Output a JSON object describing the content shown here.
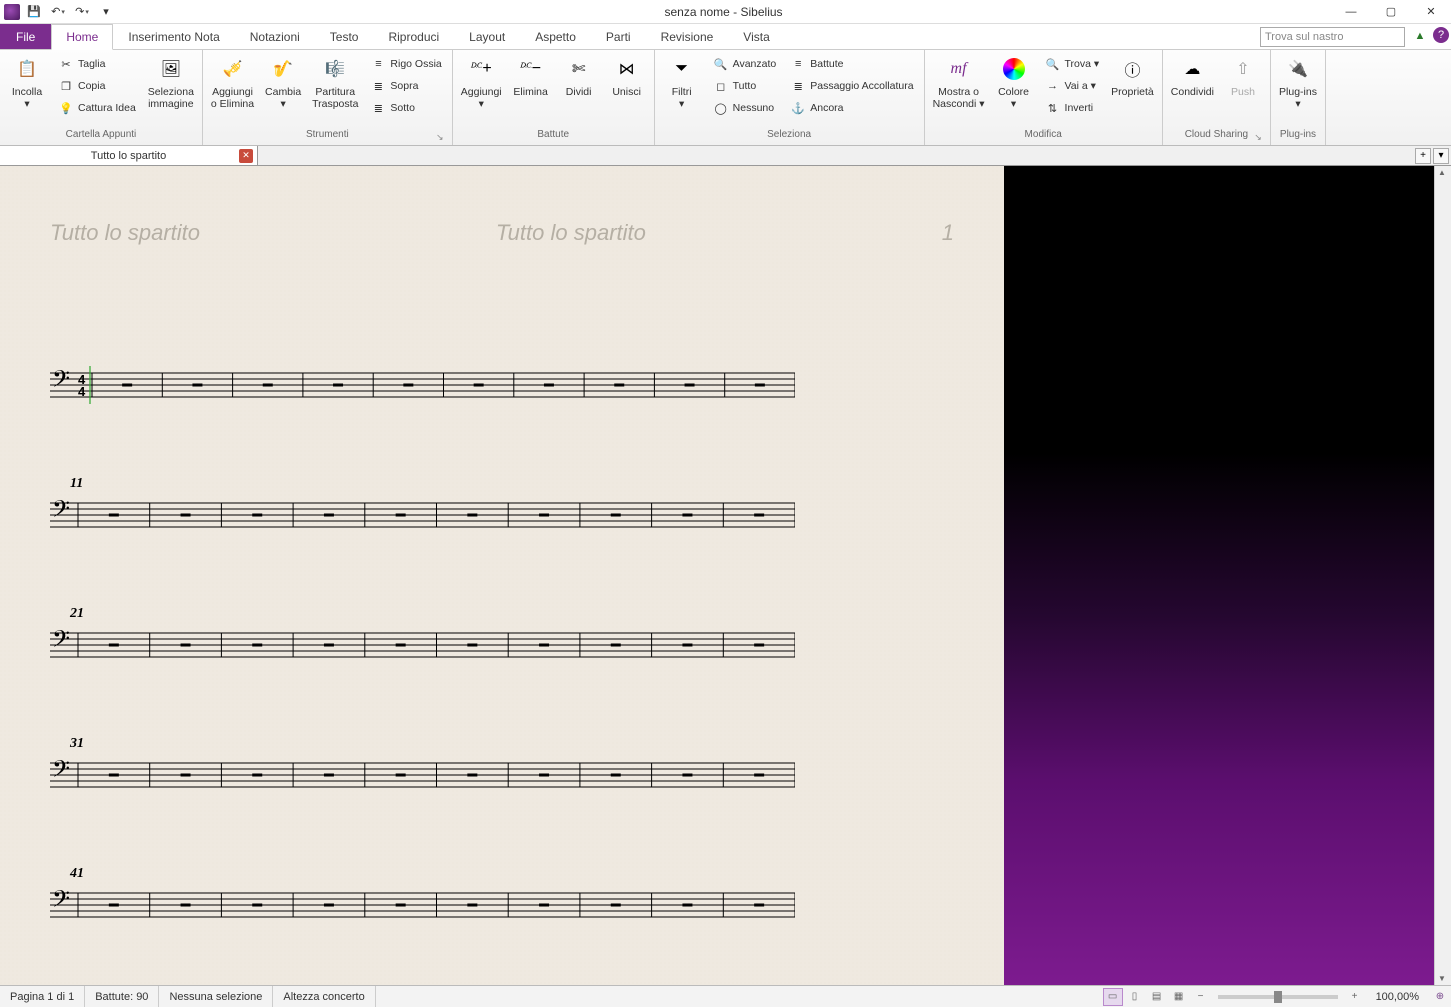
{
  "titlebar": {
    "title": "senza nome - Sibelius"
  },
  "qat": {
    "undo_tip": "↶",
    "redo_tip": "↷"
  },
  "tabs": {
    "file": "File",
    "items": [
      "Home",
      "Inserimento Nota",
      "Notazioni",
      "Testo",
      "Riproduci",
      "Layout",
      "Aspetto",
      "Parti",
      "Revisione",
      "Vista"
    ],
    "active_index": 0,
    "search_placeholder": "Trova sul nastro"
  },
  "ribbon": {
    "groups": [
      {
        "label": "Cartella Appunti",
        "big": [
          {
            "id": "incolla",
            "label": "Incolla\n▾",
            "icon": "📋"
          }
        ],
        "mini": [
          {
            "id": "taglia",
            "icon": "✂",
            "label": "Taglia"
          },
          {
            "id": "copia",
            "icon": "❐",
            "label": "Copia"
          },
          {
            "id": "cattura",
            "icon": "💡",
            "label": "Cattura Idea"
          }
        ],
        "big2": [
          {
            "id": "selimg",
            "label": "Seleziona\nimmagine",
            "icon": "🖼"
          }
        ]
      },
      {
        "label": "Strumenti",
        "launcher": true,
        "big": [
          {
            "id": "aggelim",
            "label": "Aggiungi\no Elimina",
            "icon": "🎺"
          },
          {
            "id": "cambia",
            "label": "Cambia\n▾",
            "icon": "🎷"
          },
          {
            "id": "parttr",
            "label": "Partitura\nTrasposta",
            "icon": "🎼"
          }
        ],
        "mini": [
          {
            "id": "rigoossia",
            "icon": "≡",
            "label": "Rigo Ossia"
          },
          {
            "id": "sopra",
            "icon": "≣",
            "label": "Sopra"
          },
          {
            "id": "sotto",
            "icon": "≣",
            "label": "Sotto"
          }
        ]
      },
      {
        "label": "Battute",
        "big": [
          {
            "id": "battagg",
            "label": "Aggiungi\n▾",
            "icon": "𝄊+"
          },
          {
            "id": "battelim",
            "label": "Elimina",
            "icon": "𝄊−"
          },
          {
            "id": "battdiv",
            "label": "Dividi",
            "icon": "✄"
          },
          {
            "id": "battuni",
            "label": "Unisci",
            "icon": "⋈"
          }
        ]
      },
      {
        "label": "Seleziona",
        "big": [
          {
            "id": "filtri",
            "label": "Filtri\n▾",
            "icon": "⏷"
          }
        ],
        "mini": [
          {
            "id": "avanz",
            "icon": "🔍",
            "label": "Avanzato"
          },
          {
            "id": "tutto",
            "icon": "◻",
            "label": "Tutto"
          },
          {
            "id": "nessuno",
            "icon": "◯",
            "label": "Nessuno"
          }
        ],
        "mini2": [
          {
            "id": "selbatt",
            "icon": "≡",
            "label": "Battute"
          },
          {
            "id": "passacc",
            "icon": "≣",
            "label": "Passaggio Accollatura"
          },
          {
            "id": "ancora",
            "icon": "⚓",
            "label": "Ancora"
          }
        ]
      },
      {
        "label": "Modifica",
        "big": [
          {
            "id": "mostnasc",
            "label": "Mostra o\nNascondi ▾",
            "icon": "mf"
          },
          {
            "id": "colore",
            "label": "Colore\n▾",
            "icon": "◑"
          }
        ],
        "mini": [
          {
            "id": "trova",
            "icon": "🔍",
            "label": "Trova ▾"
          },
          {
            "id": "vaia",
            "icon": "→",
            "label": "Vai a ▾"
          },
          {
            "id": "inverti",
            "icon": "⇅",
            "label": "Inverti"
          }
        ],
        "big2": [
          {
            "id": "prop",
            "label": "Proprietà",
            "icon": "ⓘ"
          }
        ]
      },
      {
        "label": "Cloud Sharing",
        "launcher": true,
        "big": [
          {
            "id": "condiv",
            "label": "Condividi",
            "icon": "☁"
          },
          {
            "id": "push",
            "label": "Push",
            "icon": "⇧",
            "disabled": true
          }
        ]
      },
      {
        "label": "Plug-ins",
        "big": [
          {
            "id": "plugins",
            "label": "Plug-ins\n▾",
            "icon": "🔌"
          }
        ]
      }
    ]
  },
  "doctab": {
    "title": "Tutto lo spartito"
  },
  "page": {
    "header_left": "Tutto lo spartito",
    "header_center": "Tutto lo spartito",
    "header_right": "1",
    "time_sig": "4/4",
    "systems": [
      {
        "barnum": "",
        "first": true,
        "bars": 10
      },
      {
        "barnum": "11",
        "bars": 10
      },
      {
        "barnum": "21",
        "bars": 10
      },
      {
        "barnum": "31",
        "bars": 10
      },
      {
        "barnum": "41",
        "bars": 10
      }
    ]
  },
  "status": {
    "page": "Pagina 1 di 1",
    "battute": "Battute: 90",
    "sel": "Nessuna selezione",
    "alt": "Altezza concerto",
    "zoom": "100,00%"
  }
}
